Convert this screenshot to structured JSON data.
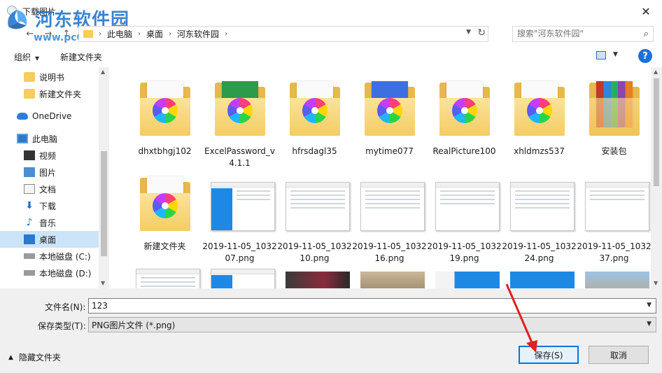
{
  "window": {
    "title": "下载图片"
  },
  "watermark": {
    "name": "河东软件园",
    "url": "www.pc0359.cn"
  },
  "address": {
    "crumbs": [
      "此电脑",
      "桌面",
      "河东软件园"
    ]
  },
  "search": {
    "placeholder": "搜索\"河东软件园\""
  },
  "toolbar": {
    "organize": "组织",
    "new_folder": "新建文件夹"
  },
  "sidebar": {
    "items": [
      {
        "label": "说明书",
        "icon": "folder-icon"
      },
      {
        "label": "新建文件夹",
        "icon": "folder-icon"
      },
      {
        "label": "OneDrive",
        "icon": "cloud-icon"
      },
      {
        "label": "此电脑",
        "icon": "computer-icon"
      },
      {
        "label": "视频",
        "icon": "video-icon"
      },
      {
        "label": "图片",
        "icon": "pictures-icon"
      },
      {
        "label": "文档",
        "icon": "document-icon"
      },
      {
        "label": "下载",
        "icon": "download-icon"
      },
      {
        "label": "音乐",
        "icon": "music-icon"
      },
      {
        "label": "桌面",
        "icon": "desktop-icon"
      },
      {
        "label": "本地磁盘 (C:)",
        "icon": "disk-icon"
      },
      {
        "label": "本地磁盘 (D:)",
        "icon": "disk-icon"
      }
    ]
  },
  "files": {
    "row1": [
      "dhxtbhgj102",
      "ExcelPassword_v4.1.1",
      "hfrsdagl35",
      "mytime077",
      "RealPicture100",
      "xhldmzs537",
      "安装包"
    ],
    "row2": [
      "新建文件夹",
      "2019-11-05_103207.png",
      "2019-11-05_103210.png",
      "2019-11-05_103216.png",
      "2019-11-05_103219.png",
      "2019-11-05_103224.png",
      "2019-11-05_103237.png"
    ]
  },
  "form": {
    "filename_label": "文件名(N):",
    "filename_value": "123",
    "filetype_label": "保存类型(T):",
    "filetype_value": "PNG图片文件 (*.png)"
  },
  "footer": {
    "hide_folders": "隐藏文件夹",
    "save": "保存(S)",
    "cancel": "取消"
  },
  "colors": {
    "accent": "#0078d7",
    "selected": "#cce4f7",
    "arrow": "#e02020"
  }
}
